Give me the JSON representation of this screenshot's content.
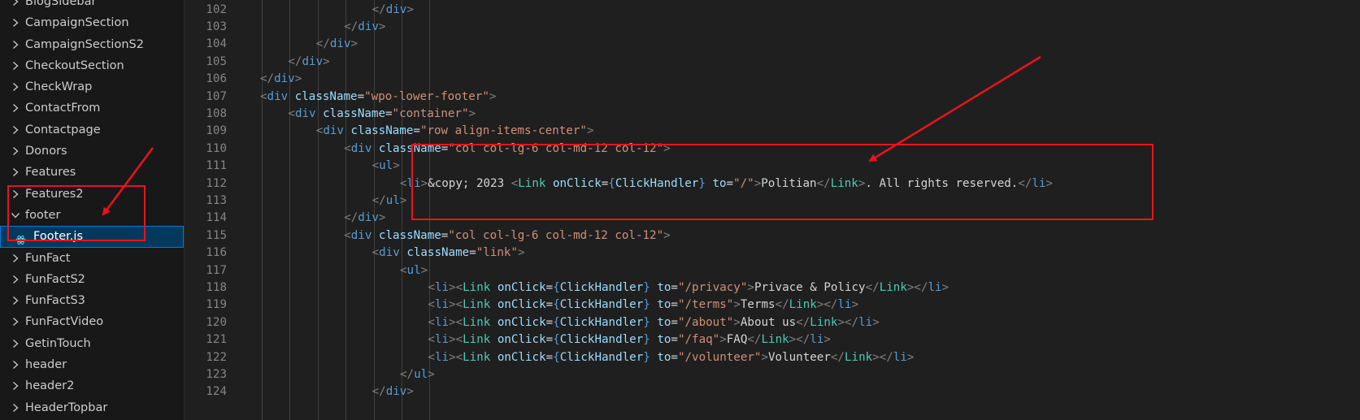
{
  "sidebar": {
    "items": [
      {
        "label": "BlogSidebar",
        "type": "folder",
        "expanded": false
      },
      {
        "label": "CampaignSection",
        "type": "folder",
        "expanded": false
      },
      {
        "label": "CampaignSectionS2",
        "type": "folder",
        "expanded": false
      },
      {
        "label": "CheckoutSection",
        "type": "folder",
        "expanded": false
      },
      {
        "label": "CheckWrap",
        "type": "folder",
        "expanded": false
      },
      {
        "label": "ContactFrom",
        "type": "folder",
        "expanded": false
      },
      {
        "label": "Contactpage",
        "type": "folder",
        "expanded": false
      },
      {
        "label": "Donors",
        "type": "folder",
        "expanded": false
      },
      {
        "label": "Features",
        "type": "folder",
        "expanded": false
      },
      {
        "label": "Features2",
        "type": "folder",
        "expanded": false
      },
      {
        "label": "footer",
        "type": "folder",
        "expanded": true
      },
      {
        "label": "Footer.js",
        "type": "file",
        "selected": true,
        "icon": "react-icon"
      },
      {
        "label": "FunFact",
        "type": "folder",
        "expanded": false
      },
      {
        "label": "FunFactS2",
        "type": "folder",
        "expanded": false
      },
      {
        "label": "FunFactS3",
        "type": "folder",
        "expanded": false
      },
      {
        "label": "FunFactVideo",
        "type": "folder",
        "expanded": false
      },
      {
        "label": "GetinTouch",
        "type": "folder",
        "expanded": false
      },
      {
        "label": "header",
        "type": "folder",
        "expanded": false
      },
      {
        "label": "header2",
        "type": "folder",
        "expanded": false
      },
      {
        "label": "HeaderTopbar",
        "type": "folder",
        "expanded": false
      }
    ]
  },
  "editor": {
    "lines": [
      {
        "n": "102",
        "indent": 6,
        "tokens": [
          [
            "br",
            "</"
          ],
          [
            "tag",
            "div"
          ],
          [
            "br",
            ">"
          ]
        ]
      },
      {
        "n": "103",
        "indent": 5,
        "tokens": [
          [
            "br",
            "</"
          ],
          [
            "tag",
            "div"
          ],
          [
            "br",
            ">"
          ]
        ]
      },
      {
        "n": "104",
        "indent": 4,
        "tokens": [
          [
            "br",
            "</"
          ],
          [
            "tag",
            "div"
          ],
          [
            "br",
            ">"
          ]
        ]
      },
      {
        "n": "105",
        "indent": 3,
        "tokens": [
          [
            "br",
            "</"
          ],
          [
            "tag",
            "div"
          ],
          [
            "br",
            ">"
          ]
        ]
      },
      {
        "n": "106",
        "indent": 2,
        "tokens": [
          [
            "br",
            "</"
          ],
          [
            "tag",
            "div"
          ],
          [
            "br",
            ">"
          ]
        ]
      },
      {
        "n": "107",
        "indent": 2,
        "tokens": [
          [
            "br",
            "<"
          ],
          [
            "tag",
            "div"
          ],
          [
            "txt",
            " "
          ],
          [
            "attr",
            "className"
          ],
          [
            "txt",
            "="
          ],
          [
            "str",
            "\"wpo-lower-footer\""
          ],
          [
            "br",
            ">"
          ]
        ]
      },
      {
        "n": "108",
        "indent": 3,
        "tokens": [
          [
            "br",
            "<"
          ],
          [
            "tag",
            "div"
          ],
          [
            "txt",
            " "
          ],
          [
            "attr",
            "className"
          ],
          [
            "txt",
            "="
          ],
          [
            "str",
            "\"container\""
          ],
          [
            "br",
            ">"
          ]
        ]
      },
      {
        "n": "109",
        "indent": 4,
        "tokens": [
          [
            "br",
            "<"
          ],
          [
            "tag",
            "div"
          ],
          [
            "txt",
            " "
          ],
          [
            "attr",
            "className"
          ],
          [
            "txt",
            "="
          ],
          [
            "str",
            "\"row align-items-center\""
          ],
          [
            "br",
            ">"
          ]
        ]
      },
      {
        "n": "110",
        "indent": 5,
        "tokens": [
          [
            "br",
            "<"
          ],
          [
            "tag",
            "div"
          ],
          [
            "txt",
            " "
          ],
          [
            "attr",
            "className"
          ],
          [
            "txt",
            "="
          ],
          [
            "str",
            "\"col col-lg-6 col-md-12 col-12\""
          ],
          [
            "br",
            ">"
          ]
        ]
      },
      {
        "n": "111",
        "indent": 6,
        "tokens": [
          [
            "br",
            "<"
          ],
          [
            "tag",
            "ul"
          ],
          [
            "br",
            ">"
          ]
        ]
      },
      {
        "n": "112",
        "indent": 7,
        "tokens": [
          [
            "br",
            "<"
          ],
          [
            "tag",
            "li"
          ],
          [
            "br",
            ">"
          ],
          [
            "txt",
            "&copy; 2023 "
          ],
          [
            "br",
            "<"
          ],
          [
            "comp",
            "Link"
          ],
          [
            "txt",
            " "
          ],
          [
            "attr",
            "onClick"
          ],
          [
            "txt",
            "="
          ],
          [
            "brace",
            "{"
          ],
          [
            "var",
            "ClickHandler"
          ],
          [
            "brace",
            "}"
          ],
          [
            "txt",
            " "
          ],
          [
            "attr",
            "to"
          ],
          [
            "txt",
            "="
          ],
          [
            "str",
            "\"/\""
          ],
          [
            "br",
            ">"
          ],
          [
            "txt",
            "Politian"
          ],
          [
            "br",
            "</"
          ],
          [
            "comp",
            "Link"
          ],
          [
            "br",
            ">"
          ],
          [
            "txt",
            ". All rights reserved."
          ],
          [
            "br",
            "</"
          ],
          [
            "tag",
            "li"
          ],
          [
            "br",
            ">"
          ]
        ]
      },
      {
        "n": "113",
        "indent": 6,
        "tokens": [
          [
            "br",
            "</"
          ],
          [
            "tag",
            "ul"
          ],
          [
            "br",
            ">"
          ]
        ]
      },
      {
        "n": "114",
        "indent": 5,
        "tokens": [
          [
            "br",
            "</"
          ],
          [
            "tag",
            "div"
          ],
          [
            "br",
            ">"
          ]
        ]
      },
      {
        "n": "115",
        "indent": 5,
        "tokens": [
          [
            "br",
            "<"
          ],
          [
            "tag",
            "div"
          ],
          [
            "txt",
            " "
          ],
          [
            "attr",
            "className"
          ],
          [
            "txt",
            "="
          ],
          [
            "str",
            "\"col col-lg-6 col-md-12 col-12\""
          ],
          [
            "br",
            ">"
          ]
        ]
      },
      {
        "n": "116",
        "indent": 6,
        "tokens": [
          [
            "br",
            "<"
          ],
          [
            "tag",
            "div"
          ],
          [
            "txt",
            " "
          ],
          [
            "attr",
            "className"
          ],
          [
            "txt",
            "="
          ],
          [
            "str",
            "\"link\""
          ],
          [
            "br",
            ">"
          ]
        ]
      },
      {
        "n": "117",
        "indent": 7,
        "tokens": [
          [
            "br",
            "<"
          ],
          [
            "tag",
            "ul"
          ],
          [
            "br",
            ">"
          ]
        ]
      },
      {
        "n": "118",
        "indent": 8,
        "tokens": [
          [
            "br",
            "<"
          ],
          [
            "tag",
            "li"
          ],
          [
            "br",
            "><"
          ],
          [
            "comp",
            "Link"
          ],
          [
            "txt",
            " "
          ],
          [
            "attr",
            "onClick"
          ],
          [
            "txt",
            "="
          ],
          [
            "brace",
            "{"
          ],
          [
            "var",
            "ClickHandler"
          ],
          [
            "brace",
            "}"
          ],
          [
            "txt",
            " "
          ],
          [
            "attr",
            "to"
          ],
          [
            "txt",
            "="
          ],
          [
            "str",
            "\"/privacy\""
          ],
          [
            "br",
            ">"
          ],
          [
            "txt",
            "Privace & Policy"
          ],
          [
            "br",
            "</"
          ],
          [
            "comp",
            "Link"
          ],
          [
            "br",
            "></"
          ],
          [
            "tag",
            "li"
          ],
          [
            "br",
            ">"
          ]
        ]
      },
      {
        "n": "119",
        "indent": 8,
        "tokens": [
          [
            "br",
            "<"
          ],
          [
            "tag",
            "li"
          ],
          [
            "br",
            "><"
          ],
          [
            "comp",
            "Link"
          ],
          [
            "txt",
            " "
          ],
          [
            "attr",
            "onClick"
          ],
          [
            "txt",
            "="
          ],
          [
            "brace",
            "{"
          ],
          [
            "var",
            "ClickHandler"
          ],
          [
            "brace",
            "}"
          ],
          [
            "txt",
            " "
          ],
          [
            "attr",
            "to"
          ],
          [
            "txt",
            "="
          ],
          [
            "str",
            "\"/terms\""
          ],
          [
            "br",
            ">"
          ],
          [
            "txt",
            "Terms"
          ],
          [
            "br",
            "</"
          ],
          [
            "comp",
            "Link"
          ],
          [
            "br",
            "></"
          ],
          [
            "tag",
            "li"
          ],
          [
            "br",
            ">"
          ]
        ]
      },
      {
        "n": "120",
        "indent": 8,
        "tokens": [
          [
            "br",
            "<"
          ],
          [
            "tag",
            "li"
          ],
          [
            "br",
            "><"
          ],
          [
            "comp",
            "Link"
          ],
          [
            "txt",
            " "
          ],
          [
            "attr",
            "onClick"
          ],
          [
            "txt",
            "="
          ],
          [
            "brace",
            "{"
          ],
          [
            "var",
            "ClickHandler"
          ],
          [
            "brace",
            "}"
          ],
          [
            "txt",
            " "
          ],
          [
            "attr",
            "to"
          ],
          [
            "txt",
            "="
          ],
          [
            "str",
            "\"/about\""
          ],
          [
            "br",
            ">"
          ],
          [
            "txt",
            "About us"
          ],
          [
            "br",
            "</"
          ],
          [
            "comp",
            "Link"
          ],
          [
            "br",
            "></"
          ],
          [
            "tag",
            "li"
          ],
          [
            "br",
            ">"
          ]
        ]
      },
      {
        "n": "121",
        "indent": 8,
        "tokens": [
          [
            "br",
            "<"
          ],
          [
            "tag",
            "li"
          ],
          [
            "br",
            "><"
          ],
          [
            "comp",
            "Link"
          ],
          [
            "txt",
            " "
          ],
          [
            "attr",
            "onClick"
          ],
          [
            "txt",
            "="
          ],
          [
            "brace",
            "{"
          ],
          [
            "var",
            "ClickHandler"
          ],
          [
            "brace",
            "}"
          ],
          [
            "txt",
            " "
          ],
          [
            "attr",
            "to"
          ],
          [
            "txt",
            "="
          ],
          [
            "str",
            "\"/faq\""
          ],
          [
            "br",
            ">"
          ],
          [
            "txt",
            "FAQ"
          ],
          [
            "br",
            "</"
          ],
          [
            "comp",
            "Link"
          ],
          [
            "br",
            "></"
          ],
          [
            "tag",
            "li"
          ],
          [
            "br",
            ">"
          ]
        ]
      },
      {
        "n": "122",
        "indent": 8,
        "tokens": [
          [
            "br",
            "<"
          ],
          [
            "tag",
            "li"
          ],
          [
            "br",
            "><"
          ],
          [
            "comp",
            "Link"
          ],
          [
            "txt",
            " "
          ],
          [
            "attr",
            "onClick"
          ],
          [
            "txt",
            "="
          ],
          [
            "brace",
            "{"
          ],
          [
            "var",
            "ClickHandler"
          ],
          [
            "brace",
            "}"
          ],
          [
            "txt",
            " "
          ],
          [
            "attr",
            "to"
          ],
          [
            "txt",
            "="
          ],
          [
            "str",
            "\"/volunteer\""
          ],
          [
            "br",
            ">"
          ],
          [
            "txt",
            "Volunteer"
          ],
          [
            "br",
            "</"
          ],
          [
            "comp",
            "Link"
          ],
          [
            "br",
            "></"
          ],
          [
            "tag",
            "li"
          ],
          [
            "br",
            ">"
          ]
        ]
      },
      {
        "n": "123",
        "indent": 7,
        "tokens": [
          [
            "br",
            "</"
          ],
          [
            "tag",
            "ul"
          ],
          [
            "br",
            ">"
          ]
        ]
      },
      {
        "n": "124",
        "indent": 6,
        "tokens": [
          [
            "br",
            "</"
          ],
          [
            "tag",
            "div"
          ],
          [
            "br",
            ">"
          ]
        ]
      }
    ]
  },
  "annotations": {
    "color": "#e8141b"
  },
  "colors": {
    "sidebar_bg": "#181818",
    "editor_bg": "#1f1f1f",
    "selection": "#04395e",
    "selection_border": "#0078d4"
  }
}
